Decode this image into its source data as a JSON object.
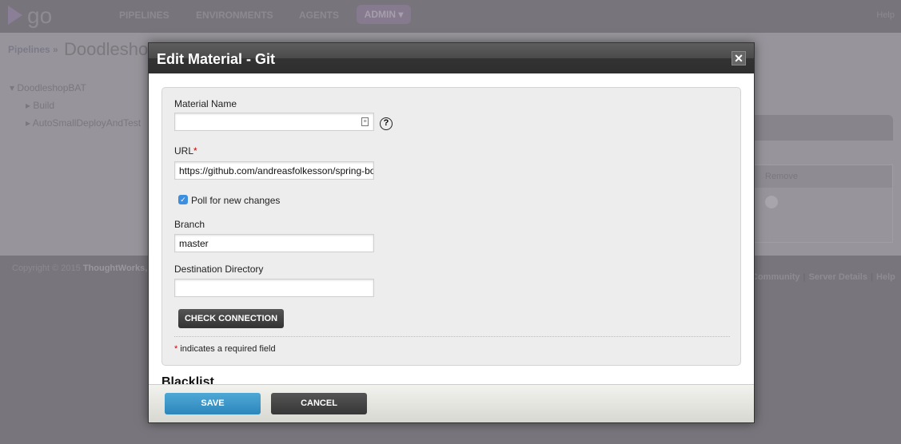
{
  "header": {
    "logo": "go",
    "nav": [
      "PIPELINES",
      "ENVIRONMENTS",
      "AGENTS"
    ],
    "admin": "ADMIN ▾",
    "help": "Help"
  },
  "breadcrumb": {
    "parent": "Pipelines",
    "separator": "»",
    "title": "Doodleshop"
  },
  "tree": {
    "root": "DoodleshopBAT",
    "children": [
      "Build",
      "AutoSmallDeployAndTest"
    ]
  },
  "right_table": {
    "header": "Remove"
  },
  "footer": {
    "copyright": "Copyright © 2015",
    "company": "ThoughtWorks,",
    "links": [
      "Community",
      "Server Details",
      "Help"
    ]
  },
  "modal": {
    "title": "Edit Material - Git",
    "close": "✕",
    "fields": {
      "material_name": {
        "label": "Material Name",
        "value": ""
      },
      "url": {
        "label": "URL",
        "required": "*",
        "value": "https://github.com/andreasfolkesson/spring-bo"
      },
      "poll": {
        "label": "Poll for new changes",
        "checked": true
      },
      "branch": {
        "label": "Branch",
        "value": "master"
      },
      "destination": {
        "label": "Destination Directory",
        "value": ""
      }
    },
    "check_connection": "CHECK CONNECTION",
    "required_star": "*",
    "required_note": "indicates a required field",
    "blacklist_heading": "Blacklist",
    "save": "SAVE",
    "cancel": "CANCEL"
  },
  "colors": {
    "save": "#3a97c9",
    "dark_button": "#3f3f3f",
    "checkbox": "#3c8fe0",
    "required": "#cc0000"
  }
}
